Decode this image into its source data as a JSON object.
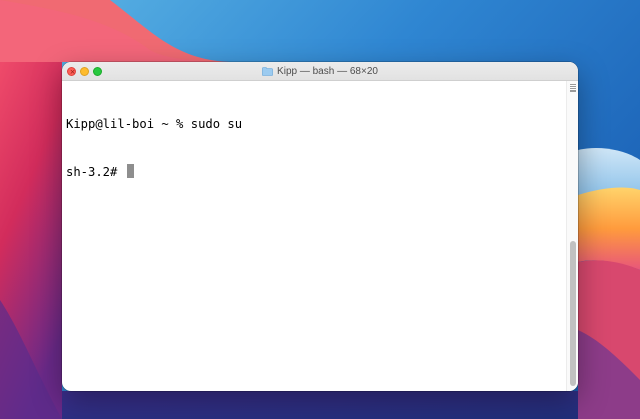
{
  "window": {
    "title": "Kipp — bash — 68×20"
  },
  "terminal": {
    "lines": [
      "Kipp@lil-boi ~ % sudo su",
      "sh-3.2# "
    ]
  },
  "icons": {
    "title_icon": "folder-icon",
    "close": "close-icon",
    "minimize": "minimize-icon",
    "zoom": "zoom-icon"
  },
  "colors": {
    "close": "#fe5f57",
    "minimize": "#febc2e",
    "zoom": "#28c840",
    "cursor": "#8e8e8e"
  }
}
